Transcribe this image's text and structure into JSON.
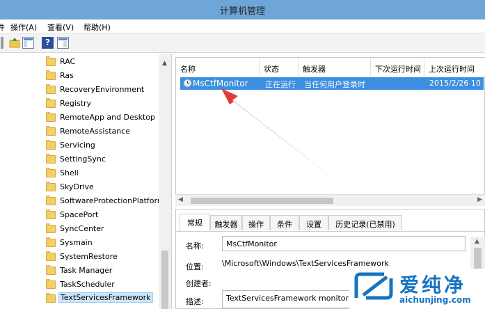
{
  "window": {
    "title": "计算机管理"
  },
  "menu": [
    "操作(A)",
    "查看(V)",
    "帮助(H)"
  ],
  "tree": {
    "items": [
      "RAC",
      "Ras",
      "RecoveryEnvironment",
      "Registry",
      "RemoteApp and Desktop",
      "RemoteAssistance",
      "Servicing",
      "SettingSync",
      "Shell",
      "SkyDrive",
      "SoftwareProtectionPlatform",
      "SpacePort",
      "SyncCenter",
      "Sysmain",
      "SystemRestore",
      "Task Manager",
      "TaskScheduler",
      "TextServicesFramework"
    ],
    "selected": "TextServicesFramework"
  },
  "task_list": {
    "columns": [
      "名称",
      "状态",
      "触发器",
      "下次运行时间",
      "上次运行时间"
    ],
    "rows": [
      {
        "name": "MsCtfMonitor",
        "status": "正在运行",
        "trigger": "当任何用户登录时",
        "next_run": "",
        "last_run": "2015/2/26 10"
      }
    ]
  },
  "details": {
    "tabs": [
      "常规",
      "触发器",
      "操作",
      "条件",
      "设置",
      "历史记录(已禁用)"
    ],
    "active_tab": "常规",
    "fields": [
      {
        "label": "名称:",
        "value": "MsCtfMonitor"
      },
      {
        "label": "位置:",
        "value": "\\Microsoft\\Windows\\TextServicesFramework"
      },
      {
        "label": "创建者:",
        "value": ""
      },
      {
        "label": "描述:",
        "value": "TextServicesFramework monitor t"
      }
    ]
  },
  "watermark": {
    "brand": "爱纯净",
    "url": "aichunjing.com"
  },
  "colors": {
    "selection": "#3c8fe0",
    "titlebar": "#6ea6d8",
    "arrow": "#e03a3a"
  }
}
